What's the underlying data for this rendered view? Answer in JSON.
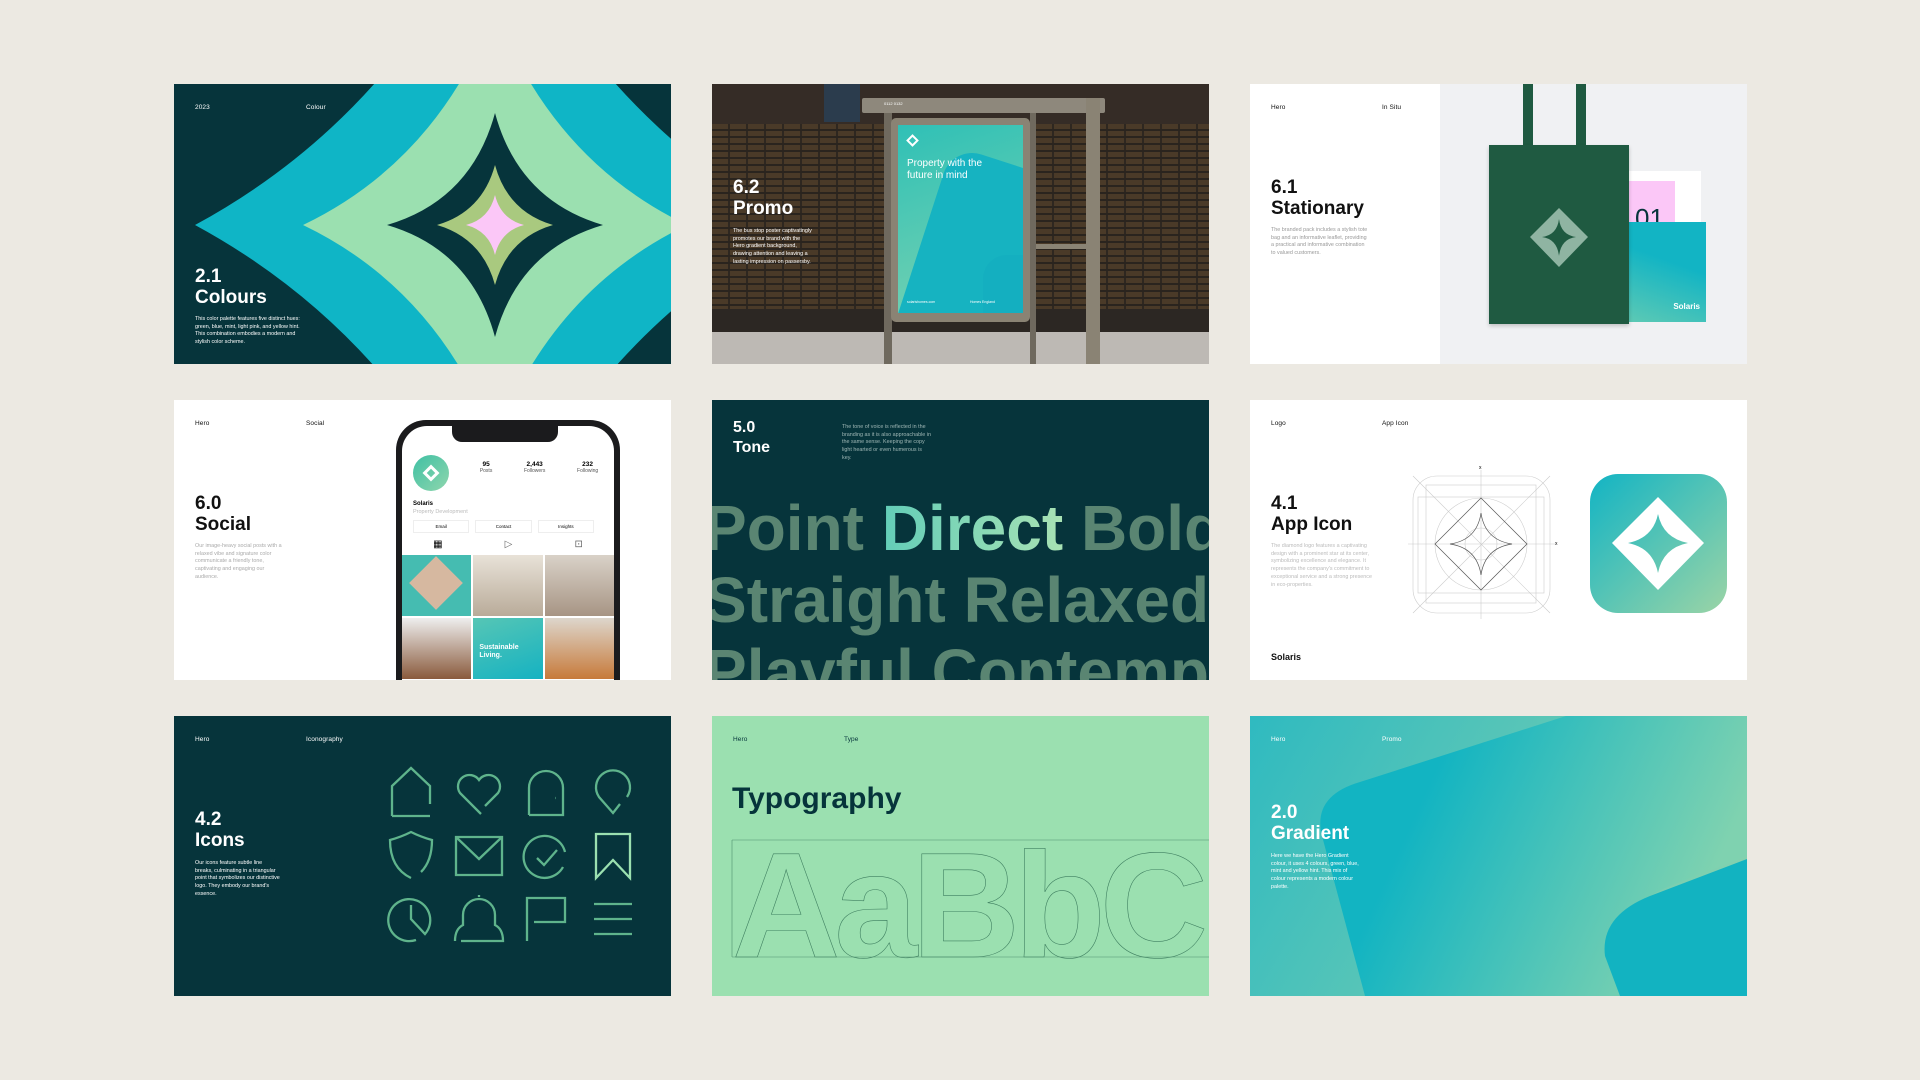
{
  "colors": {
    "background": "#ece9e2",
    "dark_teal": "#06343b",
    "cyan": "#0fb5c6",
    "mint": "#9be0b0",
    "pink": "#fbc7f7",
    "olive": "#a9c97f",
    "forest": "#1f5a41",
    "icon_line": "#5fb48c"
  },
  "cards": {
    "colours": {
      "label_left": "2023",
      "label_right": "Colour",
      "number": "2.1",
      "title": "Colours",
      "description": "This color palette features five distinct hues: green, blue, mint, light pink, and yellow hint. This combination embodies a modern and stylish color scheme."
    },
    "promo": {
      "number": "6.2",
      "title": "Promo",
      "description": "The bus stop poster captivatingly promotes our brand with the Hero gradient background, drawing attention and leaving a lasting impression on passersby.",
      "shelter_code": "0112 0132",
      "poster_headline": "Property with the future in mind",
      "poster_url": "solarishomes.com",
      "poster_partner": "Homes England"
    },
    "stationary": {
      "label_left": "Hero",
      "label_right": "In Situ",
      "number": "6.1",
      "title": "Stationary",
      "description": "The branded pack includes a stylish tote bag and an informative leaflet, providing a practical and informative combination to valued customers.",
      "leaflet_number": "01",
      "leaflet_brand": "Solaris",
      "tote_icon": "diamond-star-icon"
    },
    "social": {
      "label_left": "Hero",
      "label_right": "Social",
      "number": "6.0",
      "title": "Social",
      "description": "Our image-heavy social posts with a relaxed vibe and signature color communicate a friendly tone, captivating and engaging our audience.",
      "profile": {
        "name": "Solaris",
        "subtitle": "Property Development",
        "stats": [
          {
            "value": "95",
            "label": "Posts"
          },
          {
            "value": "2,443",
            "label": "Followers"
          },
          {
            "value": "232",
            "label": "Following"
          }
        ],
        "buttons": [
          "Email",
          "Contact",
          "Insights"
        ],
        "tabs": [
          "grid-icon",
          "play-icon",
          "tagged-icon"
        ],
        "post_caption": "Sustainable Living."
      }
    },
    "tone": {
      "number": "5.0",
      "title": "Tone",
      "description": "The tone of voice is reflected in the branding as it is also approachable in the same sense. Keeping the copy light hearted or even humerous is key.",
      "lines": [
        "Point Direct Bold",
        "Straight Relaxed",
        "Playful Contemporary"
      ],
      "highlight": "Direct"
    },
    "app_icon": {
      "label_left": "Logo",
      "label_right": "App Icon",
      "number": "4.1",
      "title": "App Icon",
      "description": "The diamond logo features a captivating design with a prominent star at its center, symbolizing excellence and elegance. It represents the company's commitment to exceptional service and a strong presence in eco-properties.",
      "brand": "Solaris",
      "grid_mark": "x"
    },
    "icons": {
      "label_left": "Hero",
      "label_right": "Iconography",
      "number": "4.2",
      "title": "Icons",
      "description": "Our icons feature subtle line breaks, culminating in a triangular point that symbolizes our distinctive logo. They embody our brand's essence.",
      "icon_names": [
        "home-icon",
        "heart-icon",
        "door-icon",
        "location-pin-icon",
        "shield-icon",
        "mail-icon",
        "check-circle-icon",
        "bookmark-icon",
        "clock-icon",
        "bell-icon",
        "flag-icon",
        "menu-icon"
      ]
    },
    "typography": {
      "label_left": "Hero",
      "label_right": "Type",
      "title": "Typography",
      "specimen": "AaBbC"
    },
    "gradient": {
      "label_left": "Hero",
      "label_right": "Promo",
      "number": "2.0",
      "title": "Gradient",
      "description": "Here we have the Hero Gradient colour, it uses 4 colours, green, blue, mint and yellow hint. This mix of colour represents a modern colour palette."
    }
  }
}
